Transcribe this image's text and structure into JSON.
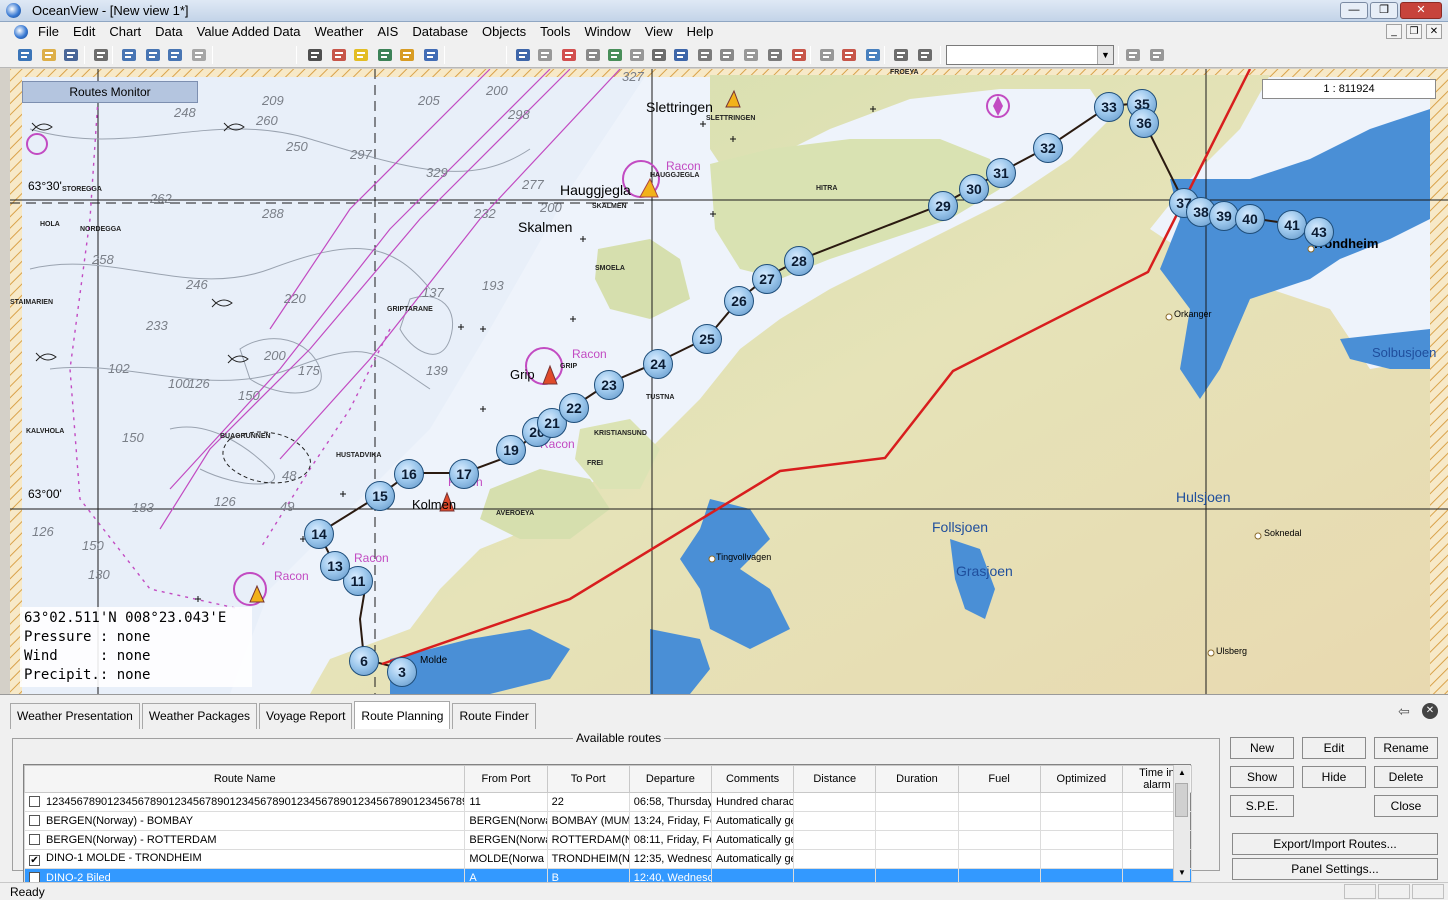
{
  "window": {
    "title": "OceanView - [New view 1*]",
    "controls": [
      "minimize",
      "maximize",
      "close"
    ]
  },
  "menu": [
    "File",
    "Edit",
    "Chart",
    "Data",
    "Value Added Data",
    "Weather",
    "AIS",
    "Database",
    "Objects",
    "Tools",
    "Window",
    "View",
    "Help"
  ],
  "toolbar": {
    "icons": [
      "globe-icon",
      "open-folder-icon",
      "save-icon",
      "print-icon",
      "zoom-in-icon",
      "zoom-out-icon",
      "undo-icon",
      "redo-icon",
      "measure-icon",
      "layers-icon",
      "edit-icon",
      "grid-icon",
      "anchor-icon",
      "buoy-icon",
      "download-icon",
      "route-icon",
      "swap-icon",
      "crop-icon",
      "chart-icon",
      "ship-icon",
      "wave-icon",
      "barometer-icon",
      "table-icon",
      "compare-icon",
      "export-icon",
      "alarm-icon",
      "flag-icon",
      "camera-icon",
      "pdf-icon",
      "forward-icon",
      "report-icon",
      "notes-icon",
      "settings-icon",
      "tools-icon"
    ],
    "combo_value": ""
  },
  "map": {
    "routes_monitor_label": "Routes Monitor",
    "scale": "1 : 811924",
    "cursor_position": "63°02.511'N 008°23.043'E",
    "info_lines": [
      "Pressure : none",
      "Wind     : none",
      "Precipit.: none"
    ],
    "lat_labels": [
      "63°30'",
      "63°00'"
    ],
    "waypoints": [
      "3",
      "6",
      "11",
      "13",
      "14",
      "15",
      "16",
      "17",
      "19",
      "20",
      "21",
      "22",
      "23",
      "24",
      "25",
      "26",
      "27",
      "28",
      "29",
      "30",
      "31",
      "32",
      "33",
      "35",
      "36",
      "37",
      "38",
      "39",
      "40",
      "41",
      "43"
    ],
    "place_names": [
      "Slettringen",
      "Hauggjegla",
      "Skalmen",
      "Grip",
      "Kolmen",
      "Trondheim",
      "Orkanger",
      "Solbusjoen",
      "Hulsjoen",
      "Follsjoen",
      "Grasjoen",
      "Soknedal",
      "Ulsberg",
      "Tingvollvagen",
      "Molde"
    ],
    "small_labels": [
      "HITRA",
      "SMOELA",
      "TUSTNA",
      "FREI",
      "KRISTIANSUND",
      "AVEROEYA",
      "HUSTADVIKA",
      "GRIPTARANE",
      "NORDEGGA",
      "STOREGGA",
      "HOLA",
      "KALVHOLA",
      "BUAGRUNNEN",
      "SLETTRINGEN",
      "HAUGGJEGLA",
      "SKALMEN",
      "GRIP",
      "FROEYA",
      "STAIMARIEN"
    ],
    "racon_labels": [
      "Racon",
      "Racon",
      "Racon",
      "Racon",
      "Racon",
      "Racon"
    ],
    "depths": [
      "248",
      "260",
      "250",
      "205",
      "200",
      "298",
      "329",
      "327",
      "297",
      "277",
      "200",
      "262",
      "288",
      "232",
      "258",
      "246",
      "220",
      "193",
      "137",
      "233",
      "200",
      "175",
      "139",
      "102",
      "100",
      "126",
      "150",
      "150",
      "126",
      "183",
      "126",
      "150",
      "130",
      "48",
      "49",
      "209"
    ]
  },
  "bottom_panel": {
    "tabs": [
      "Weather Presentation",
      "Weather Packages",
      "Voyage Report",
      "Route Planning",
      "Route Finder"
    ],
    "active_tab": "Route Planning",
    "group_title": "Available routes",
    "columns": [
      "Route Name",
      "From Port",
      "To Port",
      "Departure",
      "Comments",
      "Distance",
      "Duration",
      "Fuel",
      "Optimized",
      "Time in alarm"
    ],
    "rows": [
      {
        "checked": false,
        "name": "1234567890123456789012345678901234567890123456789012345678901234567890",
        "from": "11",
        "to": "22",
        "departure": "06:58, Thursday",
        "comments": "Hundred charac",
        "distance": "",
        "duration": "",
        "fuel": "",
        "optimized": "",
        "alarm": ""
      },
      {
        "checked": false,
        "name": "BERGEN(Norway) - BOMBAY",
        "from": "BERGEN(Norwa",
        "to": "BOMBAY (MUM",
        "departure": "13:24, Friday, Fe",
        "comments": "Automatically ge",
        "distance": "",
        "duration": "",
        "fuel": "",
        "optimized": "",
        "alarm": ""
      },
      {
        "checked": false,
        "name": "BERGEN(Norway) - ROTTERDAM",
        "from": "BERGEN(Norwa",
        "to": "ROTTERDAM(N",
        "departure": "08:11, Friday, Fe",
        "comments": "Automatically ge",
        "distance": "",
        "duration": "",
        "fuel": "",
        "optimized": "",
        "alarm": ""
      },
      {
        "checked": true,
        "name": "DINO-1 MOLDE - TRONDHEIM",
        "from": "MOLDE(Norwa",
        "to": "TRONDHEIM(N",
        "departure": "12:35, Wednesc",
        "comments": "Automatically ge",
        "distance": "",
        "duration": "",
        "fuel": "",
        "optimized": "",
        "alarm": ""
      },
      {
        "checked": false,
        "name": "DINO-2 Biled",
        "from": "A",
        "to": "B",
        "departure": "12:40, Wednesc",
        "comments": "",
        "distance": "",
        "duration": "",
        "fuel": "",
        "optimized": "",
        "alarm": "",
        "selected": true
      }
    ],
    "buttons": {
      "new": "New",
      "edit": "Edit",
      "rename": "Rename",
      "show": "Show",
      "hide": "Hide",
      "delete": "Delete",
      "spe": "S.P.E.",
      "close": "Close",
      "export_import": "Export/Import Routes...",
      "panel_settings": "Panel Settings..."
    }
  },
  "status": {
    "text": "Ready"
  },
  "colors": {
    "sea": "#eef3fb",
    "land": "#d8e0b2",
    "route_line": "#d81e1e",
    "waypoint": "#9cc7ec",
    "selection": "#3399ff",
    "magenta_lines": "#c24bc2"
  }
}
